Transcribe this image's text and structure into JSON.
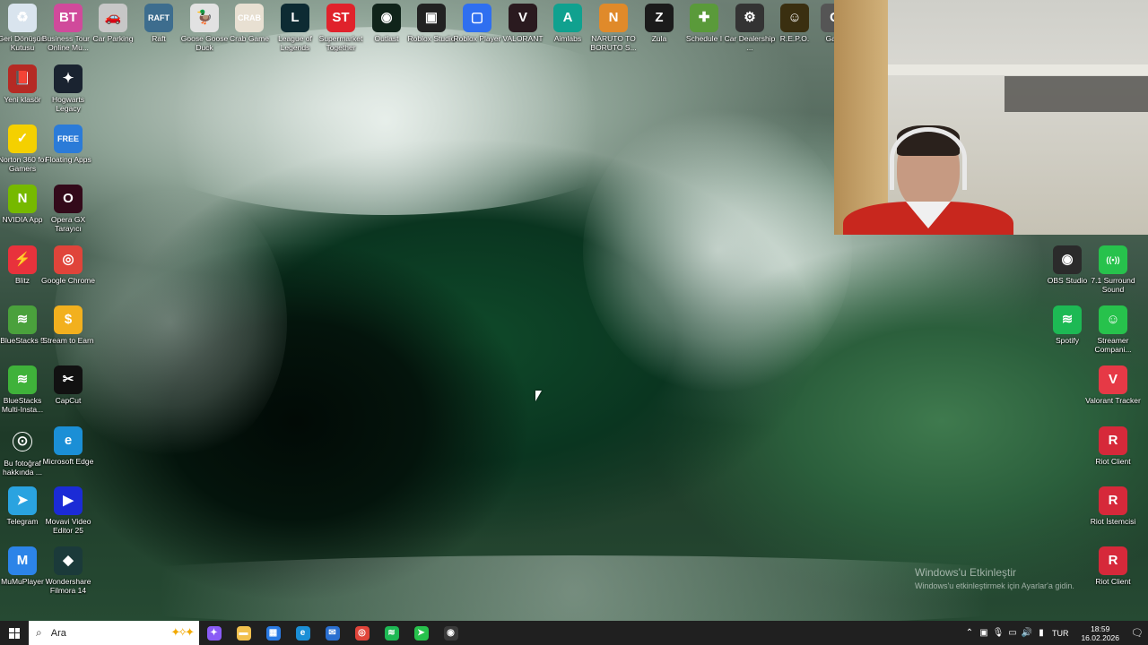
{
  "desktop_icons": [
    {
      "name": "recycle-bin-icon",
      "label": "Geri Dönüşüm Kutusu",
      "glyph": "♻",
      "color": "#d9e4ee"
    },
    {
      "name": "business-tour-icon",
      "label": "Business Tour - Online Mu...",
      "glyph": "BT",
      "color": "#d04a9b"
    },
    {
      "name": "car-parking-icon",
      "label": "Car Parking",
      "glyph": "🚗",
      "color": "#c7c7c7"
    },
    {
      "name": "raft-icon",
      "label": "Raft",
      "glyph": "RAFT",
      "color": "#3d6d8e"
    },
    {
      "name": "goose-goose-duck-icon",
      "label": "Goose Goose Duck",
      "glyph": "🦆",
      "color": "#e2e2e2"
    },
    {
      "name": "crab-game-icon",
      "label": "Crab Game",
      "glyph": "CRAB",
      "color": "#e8e0d2"
    },
    {
      "name": "league-of-legends-icon",
      "label": "League of Legends",
      "glyph": "L",
      "color": "#0d2b33"
    },
    {
      "name": "supermarket-together-icon",
      "label": "Supermarket Together",
      "glyph": "ST",
      "color": "#e0222b"
    },
    {
      "name": "outlast-icon",
      "label": "Outlast",
      "glyph": "◉",
      "color": "#10241a"
    },
    {
      "name": "roblox-studio-icon",
      "label": "Roblox Studio",
      "glyph": "▣",
      "color": "#222"
    },
    {
      "name": "roblox-player-icon",
      "label": "Roblox Player",
      "glyph": "▢",
      "color": "#2f6ff0"
    },
    {
      "name": "valorant-icon",
      "label": "VALORANT",
      "glyph": "V",
      "color": "#2a1a1f"
    },
    {
      "name": "aimlabs-icon",
      "label": "Aimlabs",
      "glyph": "A",
      "color": "#10a18f"
    },
    {
      "name": "naruto-icon",
      "label": "NARUTO TO BORUTO S...",
      "glyph": "N",
      "color": "#e08a2a"
    },
    {
      "name": "zula-icon",
      "label": "Zula",
      "glyph": "Z",
      "color": "#1b1b1b"
    },
    {
      "name": "schedule-i-icon",
      "label": "Schedule I",
      "glyph": "✚",
      "color": "#5a9a3a"
    },
    {
      "name": "car-dealership-icon",
      "label": "Car Dealership ...",
      "glyph": "⚙",
      "color": "#333"
    },
    {
      "name": "repo-icon",
      "label": "R.E.P.O.",
      "glyph": "☺",
      "color": "#3a2f10"
    },
    {
      "name": "game-icon",
      "label": "Gar...",
      "glyph": "G",
      "color": "#555"
    },
    {
      "name": "yeni-klasor-icon",
      "label": "Yeni klasör",
      "glyph": "📕",
      "color": "#b52a24"
    },
    {
      "name": "hogwarts-legacy-icon",
      "label": "Hogwarts Legacy",
      "glyph": "✦",
      "color": "#1a2330"
    },
    {
      "name": "norton-icon",
      "label": "Norton 360 for Gamers",
      "glyph": "✓",
      "color": "#f4d000"
    },
    {
      "name": "floating-apps-icon",
      "label": "Floating Apps",
      "glyph": "FREE",
      "color": "#2b7bd8"
    },
    {
      "name": "nvidia-app-icon",
      "label": "NVIDIA App",
      "glyph": "N",
      "color": "#76b900"
    },
    {
      "name": "opera-gx-icon",
      "label": "Opera GX Tarayıcı",
      "glyph": "O",
      "color": "#330a1a"
    },
    {
      "name": "blitz-icon",
      "label": "Blitz",
      "glyph": "⚡",
      "color": "#e8323c"
    },
    {
      "name": "google-chrome-icon",
      "label": "Google Chrome",
      "glyph": "◎",
      "color": "#e0443a"
    },
    {
      "name": "bluestacks-5-icon",
      "label": "BlueStacks 5",
      "glyph": "≋",
      "color": "#4aa13c"
    },
    {
      "name": "stream-to-earn-icon",
      "label": "Stream to Earn",
      "glyph": "$",
      "color": "#f2b01e"
    },
    {
      "name": "bluestacks-multi-icon",
      "label": "BlueStacks Multi-Insta...",
      "glyph": "≋",
      "color": "#3fb23a"
    },
    {
      "name": "capcut-icon",
      "label": "CapCut",
      "glyph": "✂",
      "color": "#111"
    },
    {
      "name": "bu-fotograf-icon",
      "label": "Bu fotoğraf hakkında ...",
      "glyph": "⊙",
      "color": "transparent"
    },
    {
      "name": "microsoft-edge-icon",
      "label": "Microsoft Edge",
      "glyph": "e",
      "color": "#1b8fd6"
    },
    {
      "name": "telegram-icon",
      "label": "Telegram",
      "glyph": "➤",
      "color": "#2aa3e0"
    },
    {
      "name": "movavi-icon",
      "label": "Movavi Video Editor 25",
      "glyph": "▶",
      "color": "#1b2bd6"
    },
    {
      "name": "mumuplayer-icon",
      "label": "MuMuPlayer",
      "glyph": "M",
      "color": "#2c84e8"
    },
    {
      "name": "filmora-icon",
      "label": "Wondershare Filmora 14",
      "glyph": "◆",
      "color": "#1b3a3a"
    },
    {
      "name": "obs-studio-icon",
      "label": "OBS Studio",
      "glyph": "◉",
      "color": "#2b2b2b"
    },
    {
      "name": "surround-sound-icon",
      "label": "7.1 Surround Sound",
      "glyph": "((•))",
      "color": "#27c24c"
    },
    {
      "name": "spotify-icon",
      "label": "Spotify",
      "glyph": "≋",
      "color": "#1db954"
    },
    {
      "name": "streamer-companion-icon",
      "label": "Streamer Compani...",
      "glyph": "☺",
      "color": "#27c24c"
    },
    {
      "name": "valorant-tracker-icon",
      "label": "Valorant Tracker",
      "glyph": "V",
      "color": "#e63946"
    },
    {
      "name": "riot-client-icon-1",
      "label": "Riot Client",
      "glyph": "R",
      "color": "#d6293a"
    },
    {
      "name": "riot-istemcisi-icon",
      "label": "Riot İstemcisi",
      "glyph": "R",
      "color": "#d6293a"
    },
    {
      "name": "riot-client-icon-2",
      "label": "Riot Client",
      "glyph": "R",
      "color": "#d6293a"
    }
  ],
  "watermark": {
    "title": "Windows'u Etkinleştir",
    "subtitle": "Windows'u etkinleştirmek için Ayarlar'a gidin."
  },
  "taskbar": {
    "search_placeholder": "Ara",
    "apps": [
      {
        "name": "copilot-icon",
        "glyph": "✦",
        "color": "#8a5cf6"
      },
      {
        "name": "file-explorer-icon",
        "glyph": "▬",
        "color": "#f2c14e"
      },
      {
        "name": "store-icon",
        "glyph": "▦",
        "color": "#2a7be4"
      },
      {
        "name": "edge-taskbar-icon",
        "glyph": "e",
        "color": "#1b8fd6"
      },
      {
        "name": "mail-icon",
        "glyph": "✉",
        "color": "#2a6fd0"
      },
      {
        "name": "chrome-taskbar-icon",
        "glyph": "◎",
        "color": "#e0443a"
      },
      {
        "name": "spotify-taskbar-icon",
        "glyph": "≋",
        "color": "#1db954"
      },
      {
        "name": "streamer-taskbar-icon",
        "glyph": "➤",
        "color": "#27c24c"
      },
      {
        "name": "obs-taskbar-icon",
        "glyph": "◉",
        "color": "#3a3a3a"
      }
    ],
    "language": "TUR",
    "time": "18:59",
    "date": "16.02.2026"
  }
}
